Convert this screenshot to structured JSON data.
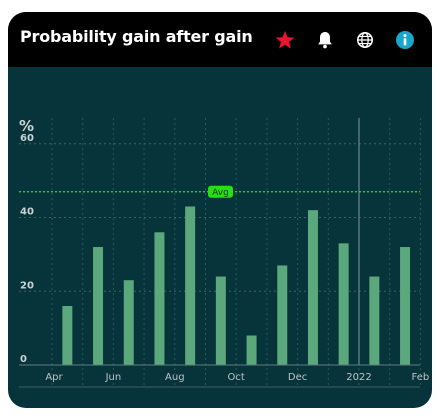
{
  "header": {
    "title": "Probability gain after gain",
    "icons": [
      "star-icon",
      "bell-icon",
      "globe-icon",
      "info-icon"
    ]
  },
  "colors": {
    "header_bg": "#000000",
    "chart_bg": "#07333b",
    "bar": "#5ba87d",
    "avg_line": "#3fdc2f",
    "avg_badge": "#27e014",
    "star": "#e8172a",
    "info": "#1aa6c8"
  },
  "chart_data": {
    "type": "bar",
    "unit_label": "%",
    "ylim": [
      0,
      67
    ],
    "yticks": [
      0,
      20,
      40,
      60
    ],
    "average": 47,
    "average_label": "Avg",
    "x_tick_labels": [
      "Apr",
      "Jun",
      "Aug",
      "Oct",
      "Dec",
      "2022",
      "Feb"
    ],
    "categories": [
      "2021-03",
      "2021-04",
      "2021-05",
      "2021-06",
      "2021-07",
      "2021-08",
      "2021-09",
      "2021-10",
      "2021-11",
      "2021-12",
      "2022-01",
      "2022-02",
      "2022-03"
    ],
    "values": [
      16,
      32,
      23,
      36,
      43,
      24,
      8,
      27,
      42,
      33,
      24,
      32
    ],
    "highlighted_category": "2022-01",
    "grid": true
  }
}
